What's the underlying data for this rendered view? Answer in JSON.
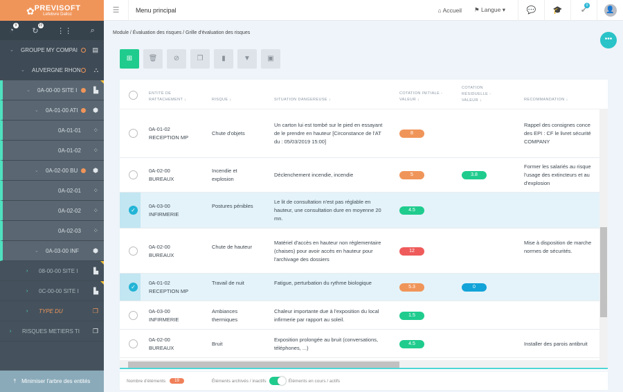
{
  "brand": {
    "name": "PREVISOFT",
    "sub": "Lefebvre Dalloz"
  },
  "sidebar_icons": [
    {
      "icon": "check-circle-icon",
      "badge": "9"
    },
    {
      "icon": "refresh-icon",
      "badge": "22"
    },
    {
      "icon": "grid-icon"
    },
    {
      "icon": "search-icon"
    }
  ],
  "tree": [
    {
      "label": "GROUPE MY COMPAI",
      "level": 0,
      "dot": "outline",
      "icon": "building-icon"
    },
    {
      "label": "AUVERGNE RHON",
      "level": 1,
      "dot": "outline",
      "icon": "hierarchy-icon"
    },
    {
      "label": "0A-00-00 SITE I",
      "level": 2,
      "dot": "filled",
      "icon": "factory-icon"
    },
    {
      "label": "0A-01-00 ATI",
      "level": 3,
      "dot": "filled",
      "icon": "cube-icon"
    },
    {
      "label": "0A-01-01",
      "level": 4,
      "icon": "workstation-icon"
    },
    {
      "label": "0A-01-02",
      "level": 4,
      "icon": "workstation-icon"
    },
    {
      "label": "0A-02-00 BU",
      "level": 3,
      "dot": "filled",
      "icon": "cube-icon"
    },
    {
      "label": "0A-02-01",
      "level": 4,
      "icon": "workstation-icon"
    },
    {
      "label": "0A-02-02",
      "level": 4,
      "icon": "workstation-icon"
    },
    {
      "label": "0A-02-03",
      "level": 4,
      "icon": "workstation-icon"
    },
    {
      "label": "0A-03-00 INF",
      "level": 3,
      "icon": "cube-icon"
    },
    {
      "label": "08-00-00 SITE I",
      "level": 2,
      "icon": "factory-icon"
    },
    {
      "label": "0C-00-00 SITE I",
      "level": 2,
      "icon": "factory-icon"
    },
    {
      "label": "TYPE DU",
      "level": 2,
      "icon": "layers-icon"
    },
    {
      "label": "RISQUES METIERS TI",
      "level": 0,
      "icon": "layers-icon"
    }
  ],
  "minimize_label": "Minimiser l'arbre des entités",
  "topbar": {
    "menu": "Menu principal",
    "home": "Accueil",
    "lang": "Langue",
    "notif_badge": "0"
  },
  "breadcrumb": "Module / Évaluation des risques / Grille d'évaluation des risques",
  "colors": {
    "orange": "#f0955a",
    "green": "#1fcc8e",
    "red": "#ef5b5b",
    "blue": "#12a3d8",
    "teal": "#2ac3c8"
  },
  "table": {
    "headers": [
      "ENTITÉ DE RATTACHEMENT ↓",
      "RISQUE ↓",
      "SITUATION DANGEREUSE ↓",
      "COTATION INITIALE - VALEUR ↓",
      "COTATION RÉSIDUELLE - VALEUR ↓",
      "RECOMMANDATION ↓"
    ],
    "rows": [
      {
        "selected": false,
        "entity": "0A-01-02 RECEPTION MP",
        "risk": "Chute d'objets",
        "situation": "Un carton lui est tombé sur le pied en essayant de le prendre en hauteur [Circonstance de l'AT du : 05/03/2019 15:00]",
        "initial": "8",
        "initial_color": "orange",
        "residual": "",
        "residual_color": "",
        "reco": "Rappel des consignes conce des EPI : CF le livret sécurité COMPANY"
      },
      {
        "selected": false,
        "entity": "0A-02-00 BUREAUX",
        "risk": "Incendie et explosion",
        "situation": "Déclenchement incendie, incendie",
        "initial": "5",
        "initial_color": "orange",
        "residual": "3.8",
        "residual_color": "green",
        "reco": "Former les salariés au risque l'usage des extincteurs et au d'explosion"
      },
      {
        "selected": true,
        "entity": "0A-03-00 INFIRMERIE",
        "risk": "Postures pénibles",
        "situation": "Le lit de consultation n'est pas réglable en hauteur, une consultation dure en moyenne 20 mn.",
        "initial": "4.5",
        "initial_color": "green",
        "residual": "",
        "residual_color": "",
        "reco": ""
      },
      {
        "selected": false,
        "entity": "0A-02-00 BUREAUX",
        "risk": "Chute de hauteur",
        "situation": "Matériel d'accès en hauteur non réglementaire (chaises) pour avoir accès en hauteur pour l'archivage des dossiers",
        "initial": "12",
        "initial_color": "red",
        "residual": "",
        "residual_color": "",
        "reco": "Mise à disposition de marche normes de sécurités."
      },
      {
        "selected": true,
        "entity": "0A-01-02 RECEPTION MP",
        "risk": "Travail de nuit",
        "situation": "Fatigue, perturbation du rythme biologique",
        "initial": "5.3",
        "initial_color": "orange",
        "residual": "0",
        "residual_color": "blue",
        "reco": ""
      },
      {
        "selected": false,
        "entity": "0A-03-00 INFIRMERIE",
        "risk": "Ambiances thermiques",
        "situation": "Chaleur importante due à l'exposition du local infirmerie par rapport au soleil.",
        "initial": "1.5",
        "initial_color": "green",
        "residual": "",
        "residual_color": "",
        "reco": ""
      },
      {
        "selected": false,
        "entity": "0A-02-00 BUREAUX",
        "risk": "Bruit",
        "situation": "Exposition prolongée au bruit (conversations, téléphones, ...)",
        "initial": "4.5",
        "initial_color": "green",
        "residual": "",
        "residual_color": "",
        "reco": "Installer des parois antibruit"
      }
    ]
  },
  "footer": {
    "count_label": "Nombre d'éléments",
    "count": "19",
    "archived_label": "Éléments archivés / inactifs",
    "active_label": "Éléments en cours / actifs",
    "toggle_on": true
  }
}
